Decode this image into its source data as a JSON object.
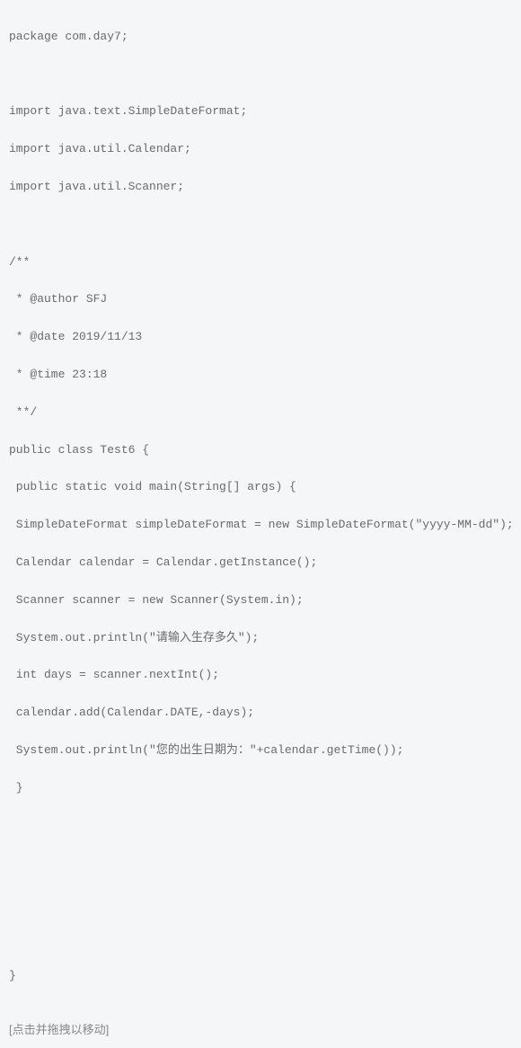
{
  "code": {
    "line1": "package com.day7;",
    "line2": "",
    "line3": "import java.text.SimpleDateFormat;",
    "line4": "import java.util.Calendar;",
    "line5": "import java.util.Scanner;",
    "line6": "",
    "line7": "/**",
    "line8": " * @author SFJ",
    "line9": " * @date 2019/11/13",
    "line10": " * @time 23:18",
    "line11": " **/",
    "line12": "public class Test6 {",
    "line13": " public static void main(String[] args) {",
    "line14": " SimpleDateFormat simpleDateFormat = new SimpleDateFormat(\"yyyy-MM-dd\");",
    "line15": " Calendar calendar = Calendar.getInstance();",
    "line16": " Scanner scanner = new Scanner(System.in);",
    "line17": " System.out.println(\"请输入生存多久\");",
    "line18": " int days = scanner.nextInt();",
    "line19": " calendar.add(Calendar.DATE,-days);",
    "line20": " System.out.println(\"您的出生日期为：\"+calendar.getTime());",
    "line21": " }",
    "line22": "",
    "line23": "",
    "line24": "",
    "line25": "",
    "line26": "}"
  },
  "footer": {
    "note": "[点击并拖拽以移动]"
  }
}
